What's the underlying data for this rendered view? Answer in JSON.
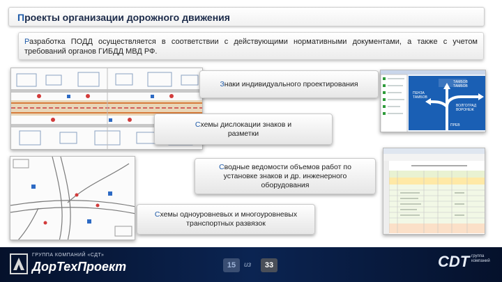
{
  "slide": {
    "title_first": "П",
    "title_rest": "роекты организации дорожного движения",
    "desc_first": "Р",
    "desc_rest": "азработка ПОДД осуществляется в соответствии с действующими нормативными документами, а также с учетом требований органов ГИБДД МВД РФ."
  },
  "callouts": [
    {
      "first": "З",
      "rest": "наки индивидуального проектирования"
    },
    {
      "first": "С",
      "rest": "хемы дислокации знаков и разметки"
    },
    {
      "first": "С",
      "rest": "водные ведомости объемов работ по установке знаков и др. инженерного оборудования"
    },
    {
      "first": "С",
      "rest": "хемы одноуровневых и многоуровневых транспортных развязок"
    }
  ],
  "sign": {
    "top": "ТАМБОВ",
    "top2": "ТАМБОВ",
    "left": "ПЕНЗА",
    "left2": "ТАМБОВ",
    "right": "ВОЛГОГРАД",
    "right2": "ВОРОНЕЖ",
    "bottom": "ПРЕВ"
  },
  "footer": {
    "brand_small": "ГРУППА КОМПАНИЙ «СДТ»",
    "brand_big": "ДорТехПроект",
    "page_current": "15",
    "page_sep": "из",
    "page_total": "33",
    "cdt": "СDT",
    "cdt_small": "группа компаний"
  },
  "colors": {
    "accent": "#1e5aa8",
    "footer_bg": "#0b2452",
    "sign_blue": "#1a5fb4",
    "page_current_bg": "#3a4e73",
    "page_total_bg": "#4a4f59"
  }
}
